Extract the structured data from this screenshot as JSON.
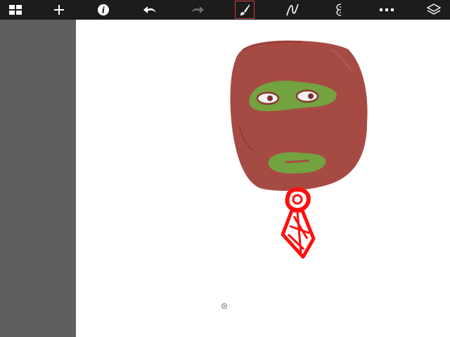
{
  "toolbar": {
    "buttons": [
      {
        "name": "gallery-grid-icon",
        "active": false
      },
      {
        "name": "new-plus-icon",
        "active": false
      },
      {
        "name": "info-icon",
        "active": false
      },
      {
        "name": "undo-arrow-icon",
        "active": false
      },
      {
        "name": "redo-arrow-icon",
        "active": false,
        "disabled": true
      },
      {
        "name": "brush-icon",
        "active": true
      },
      {
        "name": "curve-pen-icon",
        "active": false
      },
      {
        "name": "symmetry-icon",
        "active": false
      },
      {
        "name": "more-dots-icon",
        "active": false
      },
      {
        "name": "layers-icon",
        "active": false
      }
    ],
    "icon_color": "#ffffff",
    "disabled_color": "#6e6e6e",
    "active_border_color": "#d63a3a"
  },
  "sidebar": {
    "color": "#5f5f5f"
  },
  "canvas": {
    "background": "#ffffff",
    "drawing": {
      "head_color": "#a64b44",
      "mask_color": "#73a33f",
      "eye_white": "#f2f2f2",
      "pupil_color": "#7a2f2f",
      "tie_color": "#ff0f0f"
    }
  }
}
